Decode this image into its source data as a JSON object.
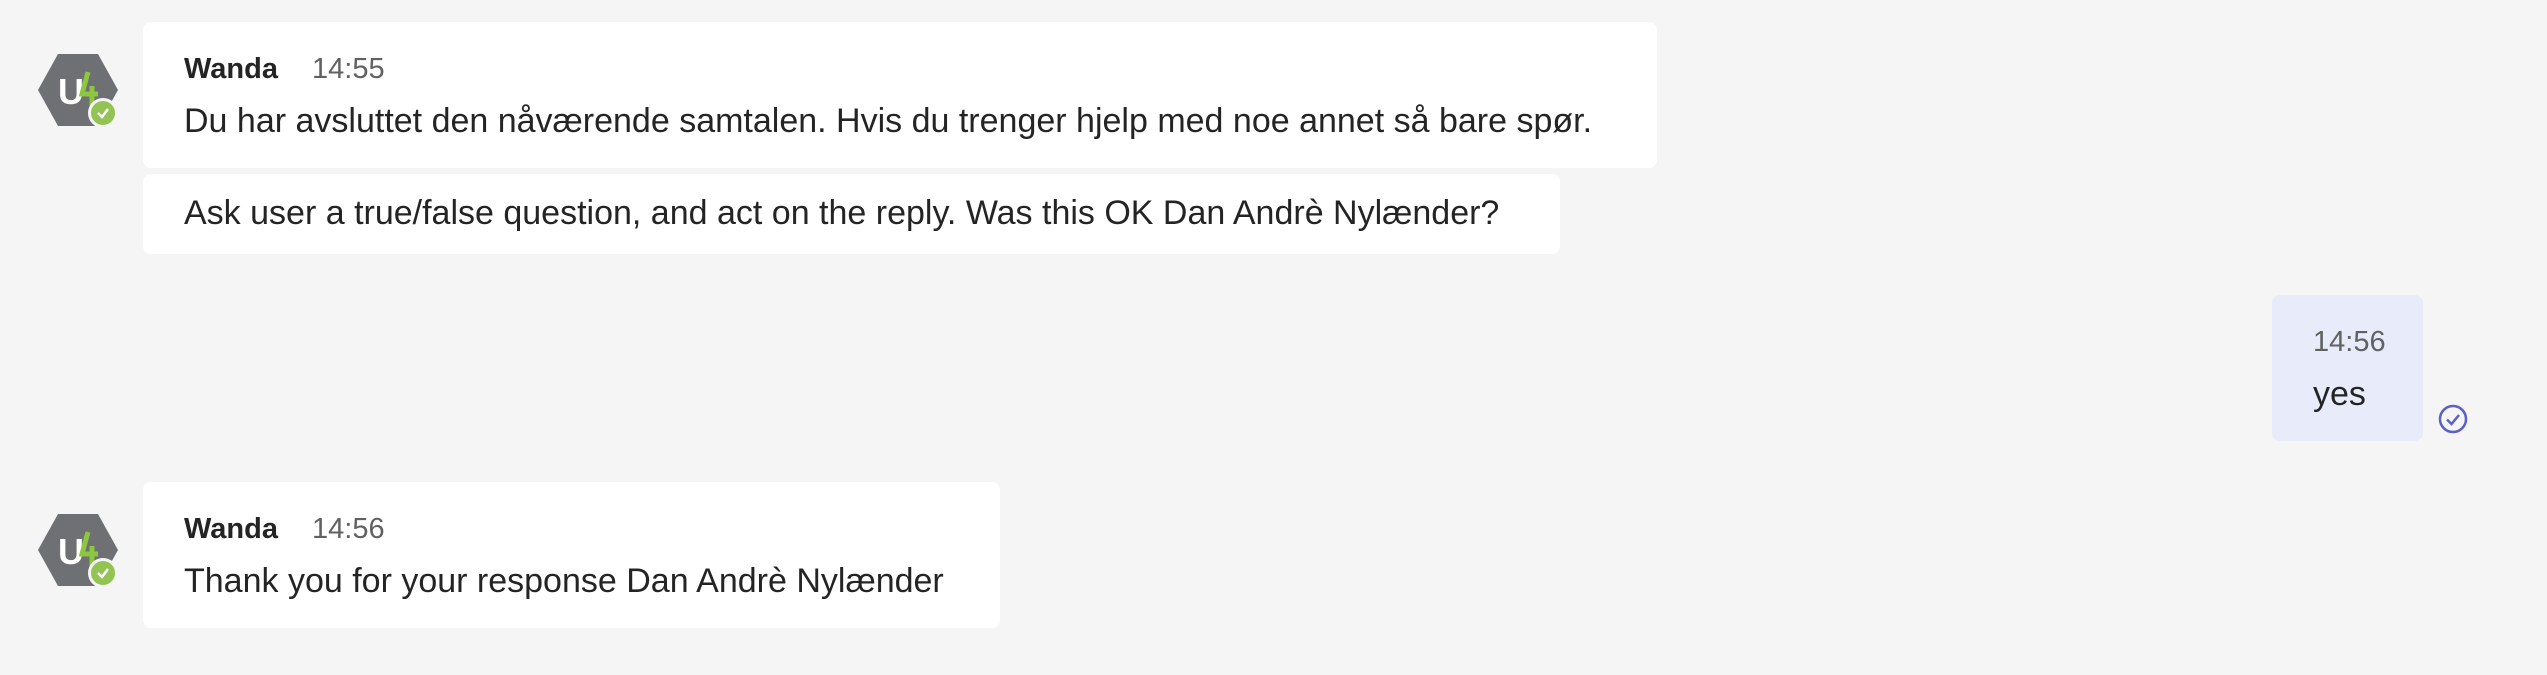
{
  "messages": [
    {
      "sender": "Wanda",
      "time": "14:55",
      "avatar_icon": "bot-logo-icon",
      "presence": "available",
      "text": "Du har avsluttet den nåværende samtalen. Hvis du trenger hjelp med noe annet så bare spør.",
      "followup": "Ask user a true/false question, and act on the reply. Was this OK Dan Andrè Nylænder?"
    },
    {
      "self": true,
      "time": "14:56",
      "text": "yes",
      "status_icon": "seen-check-icon"
    },
    {
      "sender": "Wanda",
      "time": "14:56",
      "avatar_icon": "bot-logo-icon",
      "presence": "available",
      "text": "Thank you for your response Dan Andrè Nylænder"
    }
  ],
  "colors": {
    "background": "#f5f5f5",
    "bubble": "#ffffff",
    "self_bubble": "#e8ebfa",
    "presence_available": "#92c353",
    "avatar_hex": "#6e7073",
    "logo_accent": "#8dc63f"
  }
}
